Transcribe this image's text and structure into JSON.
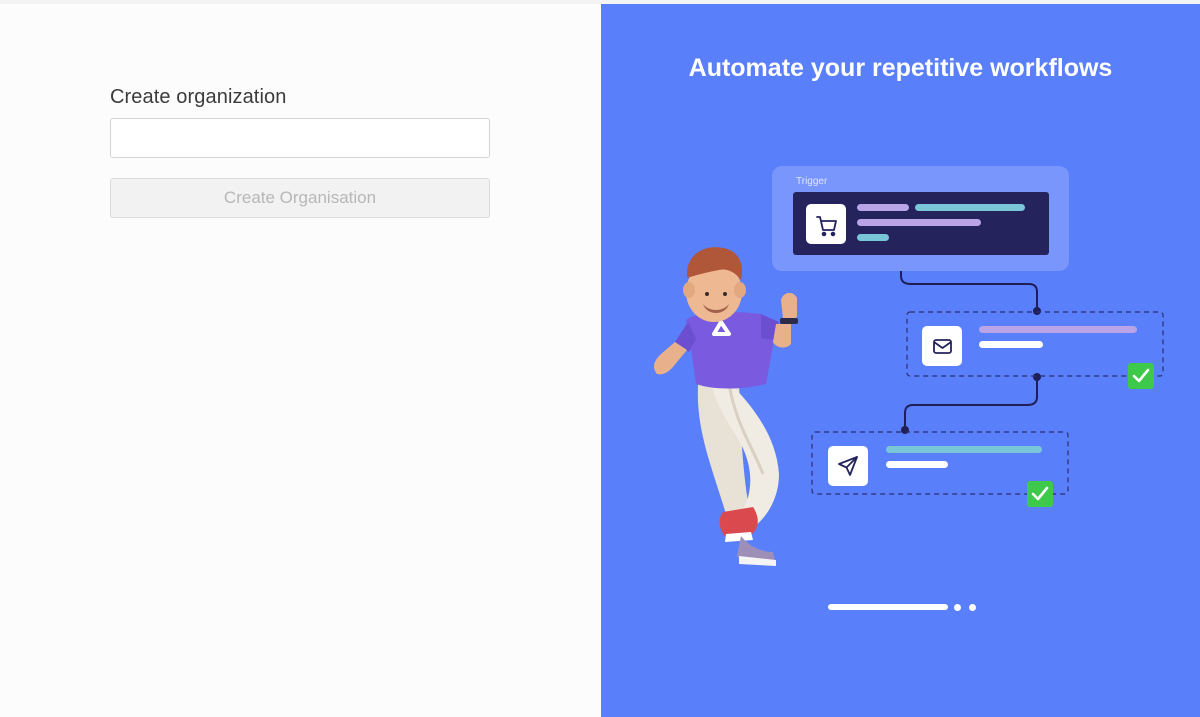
{
  "form": {
    "title": "Create organization",
    "org_name_value": "",
    "submit_label": "Create Organisation"
  },
  "promo": {
    "headline": "Automate your repetitive workflows",
    "trigger_label": "Trigger",
    "steps": [
      {
        "icon": "cart-icon",
        "status": "trigger"
      },
      {
        "icon": "mail-icon",
        "status": "done"
      },
      {
        "icon": "send-icon",
        "status": "done"
      }
    ],
    "carousel": {
      "slide_count": 3,
      "active_index": 0
    }
  },
  "colors": {
    "panel_blue": "#5a7ffa",
    "card_dark": "#25235c",
    "check_green": "#3ec94b",
    "bar_purple": "#b8a4e6",
    "bar_teal": "#78c6d8"
  }
}
